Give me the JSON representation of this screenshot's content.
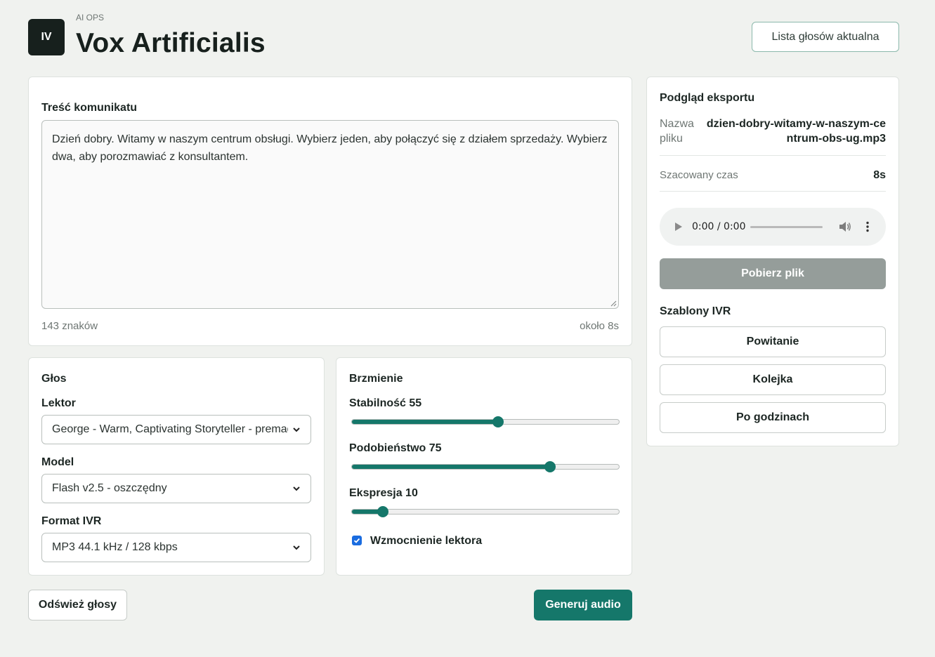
{
  "header": {
    "logo_text": "IV",
    "eyebrow": "AI OPS",
    "title": "Vox Artificialis",
    "status_button": "Lista głosów aktualna"
  },
  "message": {
    "label": "Treść komunikatu",
    "text": "Dzień dobry. Witamy w naszym centrum obsługi. Wybierz jeden, aby połączyć się z działem sprzedaży. Wybierz dwa, aby porozmawiać z konsultantem.",
    "char_count": "143 znaków",
    "duration_estimate": "około 8s"
  },
  "voice": {
    "title": "Głos",
    "speaker_label": "Lektor",
    "speaker_value": "George - Warm, Captivating Storyteller - premade",
    "model_label": "Model",
    "model_value": "Flash v2.5 - oszczędny",
    "format_label": "Format IVR",
    "format_value": "MP3 44.1 kHz / 128 kbps"
  },
  "sound": {
    "title": "Brzmienie",
    "stability_label": "Stabilność 55",
    "stability_value": 55,
    "similarity_label": "Podobieństwo 75",
    "similarity_value": 75,
    "expression_label": "Ekspresja 10",
    "expression_value": 10,
    "boost_label": "Wzmocnienie lektora",
    "boost_checked": true
  },
  "actions": {
    "refresh_label": "Odśwież głosy",
    "generate_label": "Generuj audio"
  },
  "export": {
    "title": "Podgląd eksportu",
    "filename_label": "Nazwa pliku",
    "filename_value": "dzien-dobry-witamy-w-naszym-centrum-obs-ug.mp3",
    "time_label": "Szacowany czas",
    "time_value": "8s",
    "audio_time": "0:00 / 0:00",
    "download_label": "Pobierz plik"
  },
  "templates": {
    "title": "Szablony IVR",
    "items": [
      "Powitanie",
      "Kolejka",
      "Po godzinach"
    ]
  },
  "colors": {
    "accent": "#15776a",
    "background": "#f0f2ef",
    "disabled": "#959d9a",
    "checkbox": "#1a6ce0"
  }
}
